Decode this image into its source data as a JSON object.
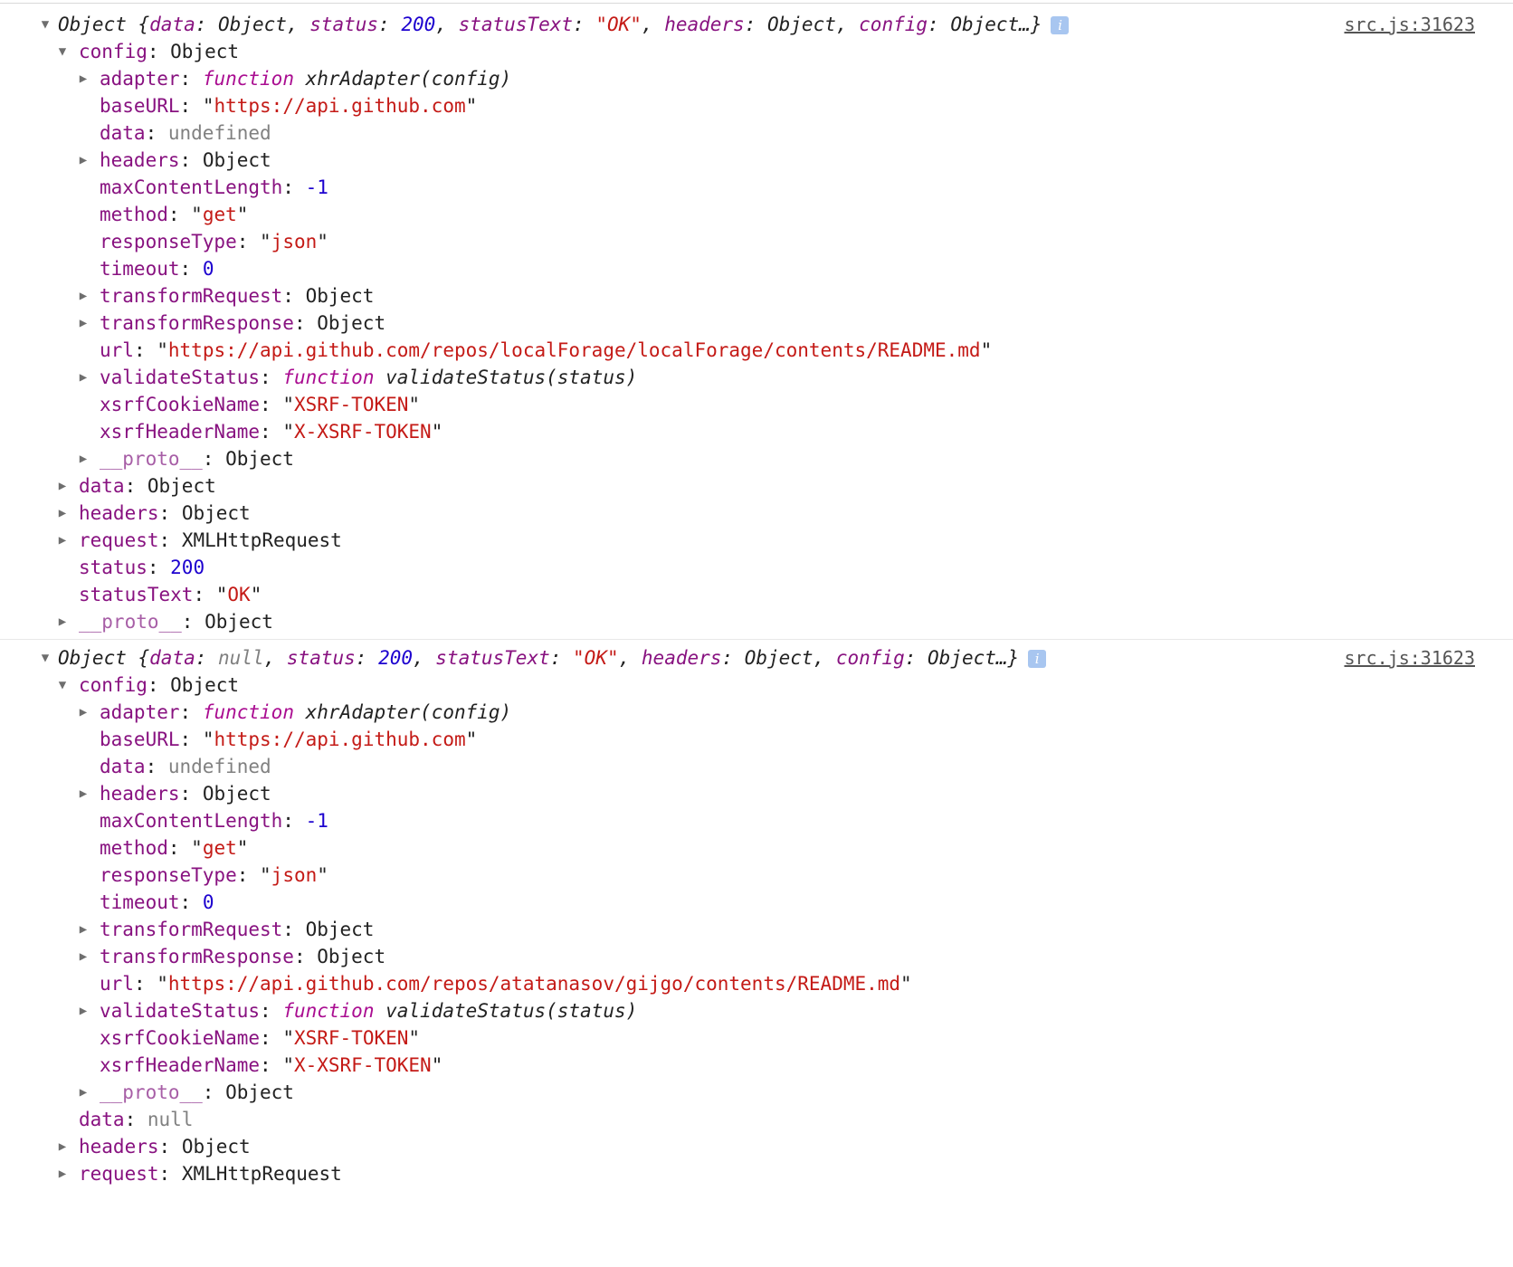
{
  "entries": [
    {
      "header": {
        "prefix": "Object {",
        "parts": [
          {
            "key": "data",
            "value": "Object",
            "kind": "obj"
          },
          {
            "key": "status",
            "value": "200",
            "kind": "num"
          },
          {
            "key": "statusText",
            "value": "\"OK\"",
            "kind": "str"
          },
          {
            "key": "headers",
            "value": "Object",
            "kind": "obj"
          },
          {
            "key": "config",
            "value": "Object…}",
            "kind": "obj"
          }
        ],
        "info_icon": "info-icon",
        "source_link": "src.js:31623"
      },
      "rows": [
        {
          "depth": 1,
          "toggle": "expanded",
          "key": "config",
          "value": "Object",
          "kind": "obj"
        },
        {
          "depth": 2,
          "toggle": "collapsed",
          "key": "adapter",
          "value": "xhrAdapter(config)",
          "kind": "fn"
        },
        {
          "depth": 2,
          "toggle": "none",
          "key": "baseURL",
          "value": "https://api.github.com",
          "kind": "str"
        },
        {
          "depth": 2,
          "toggle": "none",
          "key": "data",
          "value": "undefined",
          "kind": "undef"
        },
        {
          "depth": 2,
          "toggle": "collapsed",
          "key": "headers",
          "value": "Object",
          "kind": "obj"
        },
        {
          "depth": 2,
          "toggle": "none",
          "key": "maxContentLength",
          "value": "-1",
          "kind": "num"
        },
        {
          "depth": 2,
          "toggle": "none",
          "key": "method",
          "value": "get",
          "kind": "str"
        },
        {
          "depth": 2,
          "toggle": "none",
          "key": "responseType",
          "value": "json",
          "kind": "str"
        },
        {
          "depth": 2,
          "toggle": "none",
          "key": "timeout",
          "value": "0",
          "kind": "num"
        },
        {
          "depth": 2,
          "toggle": "collapsed",
          "key": "transformRequest",
          "value": "Object",
          "kind": "obj"
        },
        {
          "depth": 2,
          "toggle": "collapsed",
          "key": "transformResponse",
          "value": "Object",
          "kind": "obj"
        },
        {
          "depth": 2,
          "toggle": "none",
          "key": "url",
          "value": "https://api.github.com/repos/localForage/localForage/contents/README.md",
          "kind": "str"
        },
        {
          "depth": 2,
          "toggle": "collapsed",
          "key": "validateStatus",
          "value": "validateStatus(status)",
          "kind": "fn"
        },
        {
          "depth": 2,
          "toggle": "none",
          "key": "xsrfCookieName",
          "value": "XSRF-TOKEN",
          "kind": "str"
        },
        {
          "depth": 2,
          "toggle": "none",
          "key": "xsrfHeaderName",
          "value": "X-XSRF-TOKEN",
          "kind": "str"
        },
        {
          "depth": 2,
          "toggle": "collapsed",
          "key": "__proto__",
          "value": "Object",
          "kind": "obj",
          "dim": true
        },
        {
          "depth": 1,
          "toggle": "collapsed",
          "key": "data",
          "value": "Object",
          "kind": "obj"
        },
        {
          "depth": 1,
          "toggle": "collapsed",
          "key": "headers",
          "value": "Object",
          "kind": "obj"
        },
        {
          "depth": 1,
          "toggle": "collapsed",
          "key": "request",
          "value": "XMLHttpRequest",
          "kind": "obj"
        },
        {
          "depth": 1,
          "toggle": "none",
          "key": "status",
          "value": "200",
          "kind": "num"
        },
        {
          "depth": 1,
          "toggle": "none",
          "key": "statusText",
          "value": "OK",
          "kind": "str"
        },
        {
          "depth": 1,
          "toggle": "collapsed",
          "key": "__proto__",
          "value": "Object",
          "kind": "obj",
          "dim": true
        }
      ]
    },
    {
      "header": {
        "prefix": "Object {",
        "parts": [
          {
            "key": "data",
            "value": "null",
            "kind": "undef"
          },
          {
            "key": "status",
            "value": "200",
            "kind": "num"
          },
          {
            "key": "statusText",
            "value": "\"OK\"",
            "kind": "str"
          },
          {
            "key": "headers",
            "value": "Object",
            "kind": "obj"
          },
          {
            "key": "config",
            "value": "Object…}",
            "kind": "obj"
          }
        ],
        "info_icon": "info-icon",
        "source_link": "src.js:31623"
      },
      "rows": [
        {
          "depth": 1,
          "toggle": "expanded",
          "key": "config",
          "value": "Object",
          "kind": "obj"
        },
        {
          "depth": 2,
          "toggle": "collapsed",
          "key": "adapter",
          "value": "xhrAdapter(config)",
          "kind": "fn"
        },
        {
          "depth": 2,
          "toggle": "none",
          "key": "baseURL",
          "value": "https://api.github.com",
          "kind": "str"
        },
        {
          "depth": 2,
          "toggle": "none",
          "key": "data",
          "value": "undefined",
          "kind": "undef"
        },
        {
          "depth": 2,
          "toggle": "collapsed",
          "key": "headers",
          "value": "Object",
          "kind": "obj"
        },
        {
          "depth": 2,
          "toggle": "none",
          "key": "maxContentLength",
          "value": "-1",
          "kind": "num"
        },
        {
          "depth": 2,
          "toggle": "none",
          "key": "method",
          "value": "get",
          "kind": "str"
        },
        {
          "depth": 2,
          "toggle": "none",
          "key": "responseType",
          "value": "json",
          "kind": "str"
        },
        {
          "depth": 2,
          "toggle": "none",
          "key": "timeout",
          "value": "0",
          "kind": "num"
        },
        {
          "depth": 2,
          "toggle": "collapsed",
          "key": "transformRequest",
          "value": "Object",
          "kind": "obj"
        },
        {
          "depth": 2,
          "toggle": "collapsed",
          "key": "transformResponse",
          "value": "Object",
          "kind": "obj"
        },
        {
          "depth": 2,
          "toggle": "none",
          "key": "url",
          "value": "https://api.github.com/repos/atatanasov/gijgo/contents/README.md",
          "kind": "str"
        },
        {
          "depth": 2,
          "toggle": "collapsed",
          "key": "validateStatus",
          "value": "validateStatus(status)",
          "kind": "fn"
        },
        {
          "depth": 2,
          "toggle": "none",
          "key": "xsrfCookieName",
          "value": "XSRF-TOKEN",
          "kind": "str"
        },
        {
          "depth": 2,
          "toggle": "none",
          "key": "xsrfHeaderName",
          "value": "X-XSRF-TOKEN",
          "kind": "str"
        },
        {
          "depth": 2,
          "toggle": "collapsed",
          "key": "__proto__",
          "value": "Object",
          "kind": "obj",
          "dim": true
        },
        {
          "depth": 1,
          "toggle": "none",
          "key": "data",
          "value": "null",
          "kind": "undef"
        },
        {
          "depth": 1,
          "toggle": "collapsed",
          "key": "headers",
          "value": "Object",
          "kind": "obj"
        },
        {
          "depth": 1,
          "toggle": "collapsed",
          "key": "request",
          "value": "XMLHttpRequest",
          "kind": "obj"
        }
      ]
    }
  ],
  "function_keyword": "function",
  "glyphs": {
    "expanded": "▼",
    "collapsed": "▶"
  }
}
